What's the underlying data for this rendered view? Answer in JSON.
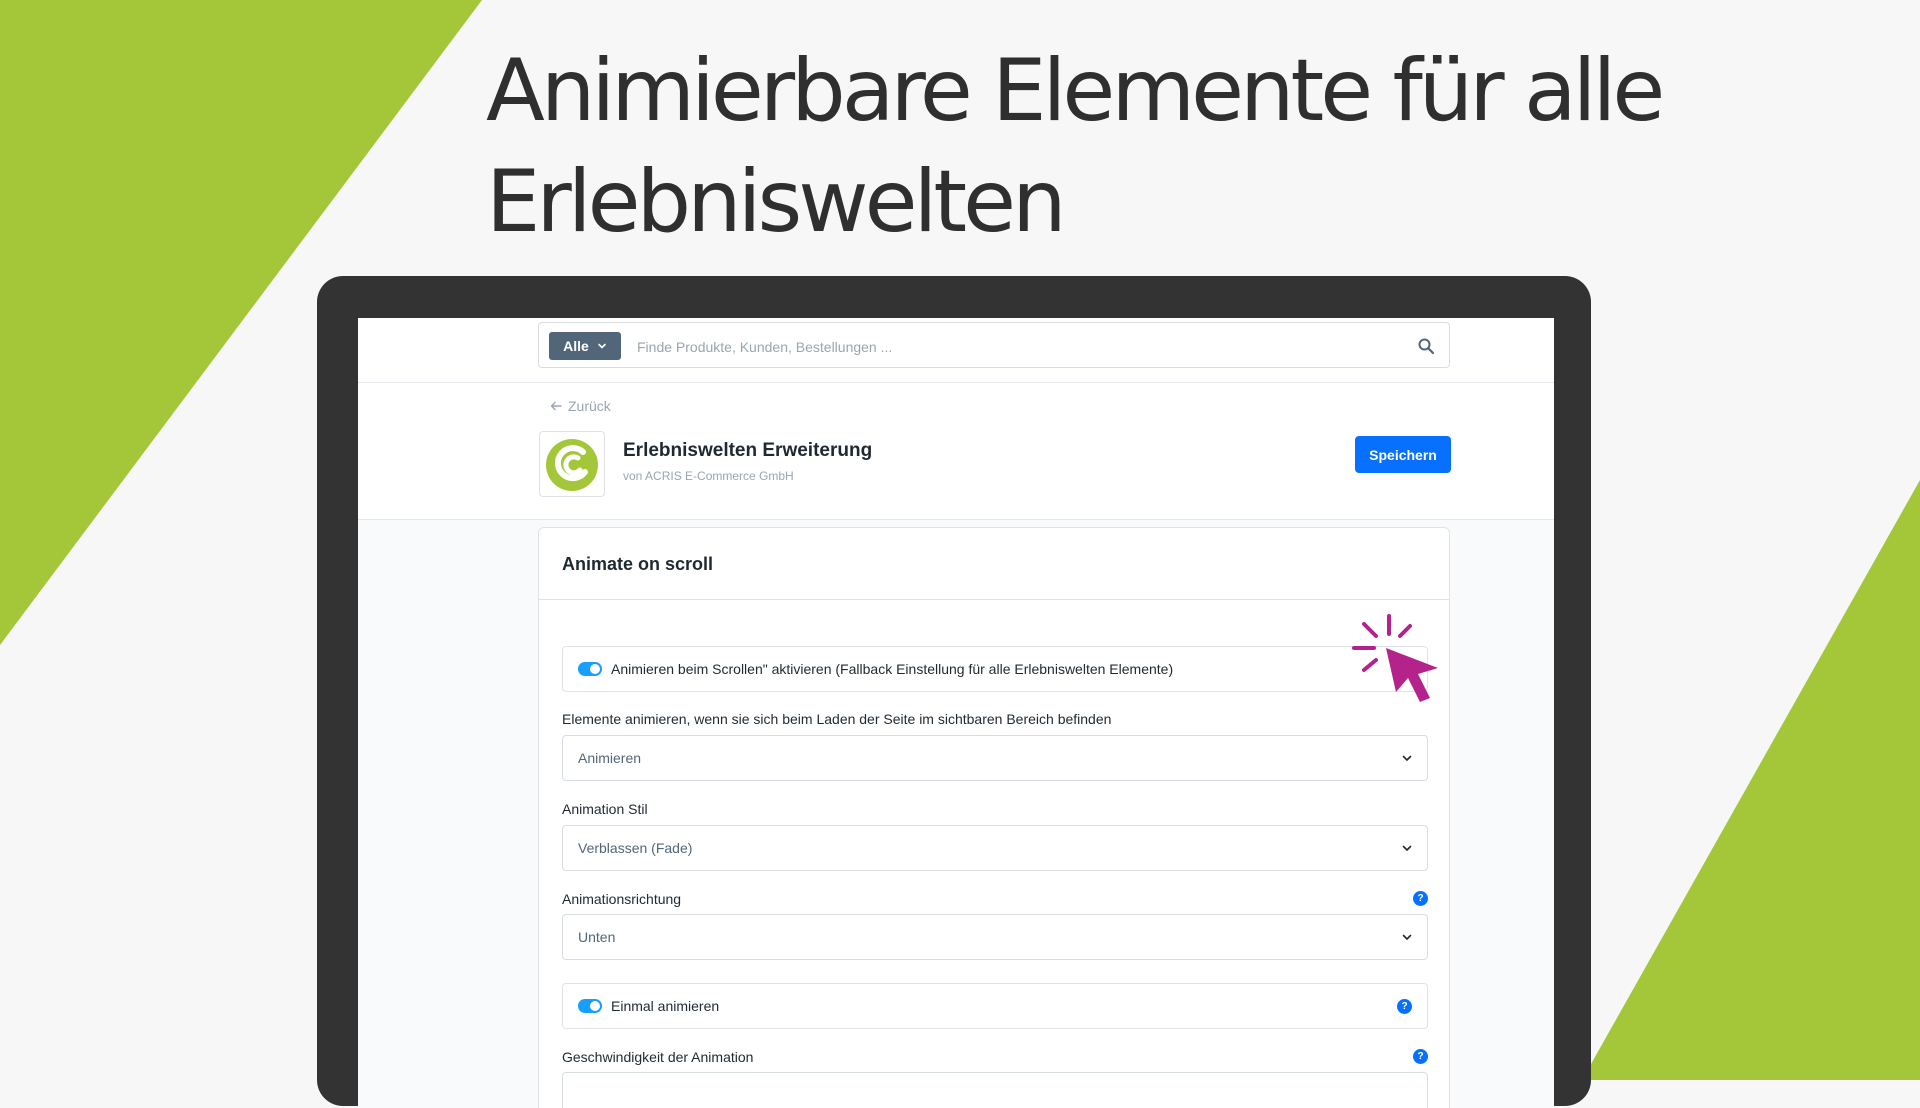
{
  "headline": {
    "line1": "Animierbare Elemente für alle",
    "line2": "Erlebniswelten"
  },
  "colors": {
    "brand_green": "#a4c639",
    "frame": "#333333",
    "primary_button": "#0870ff",
    "toggle_on": "#189eff",
    "cursor_magenta": "#b3238b"
  },
  "search": {
    "filter_label": "Alle",
    "placeholder": "Finde Produkte, Kunden, Bestellungen ..."
  },
  "header": {
    "back_label": "Zurück",
    "plugin_title": "Erlebniswelten Erweiterung",
    "vendor": "von ACRIS E-Commerce GmbH",
    "save_label": "Speichern"
  },
  "card": {
    "title": "Animate on scroll",
    "switch_scroll_label": "Animieren beim Scrollen\" aktivieren (Fallback Einstellung für alle Erlebniswelten Elemente)",
    "switch_scroll_on": true,
    "field_visible_label": "Elemente animieren, wenn sie sich beim Laden der Seite im sichtbaren Bereich befinden",
    "field_visible_value": "Animieren",
    "field_style_label": "Animation Stil",
    "field_style_value": "Verblassen (Fade)",
    "field_direction_label": "Animationsrichtung",
    "field_direction_value": "Unten",
    "switch_once_label": "Einmal animieren",
    "switch_once_on": true,
    "field_speed_label": "Geschwindigkeit der Animation",
    "help_glyph": "?"
  },
  "icons": {
    "filter_chevron": "chevron-down-icon",
    "search": "search-icon",
    "back": "arrow-left-icon",
    "logo": "acris-logo-icon",
    "select_chevron": "chevron-down-icon",
    "help": "help-icon",
    "cursor": "click-cursor-icon"
  }
}
